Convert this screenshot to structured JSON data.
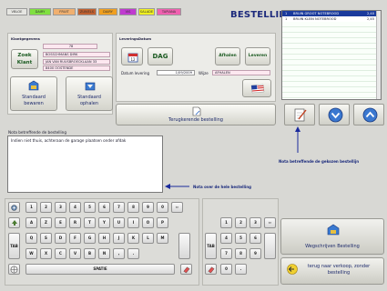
{
  "categories": [
    {
      "label": "VBLOE",
      "bg": "#e6e6e2"
    },
    {
      "label": "DAIRY",
      "bg": "#80e040"
    },
    {
      "label": "FRUIT",
      "bg": "#f0b070"
    },
    {
      "label": "ZUIVELS",
      "bg": "#c06030"
    },
    {
      "label": "DAIRY",
      "bg": "#f0a020"
    },
    {
      "label": "VIS",
      "bg": "#c03ad0"
    },
    {
      "label": "SALADE",
      "bg": "#f0f020"
    },
    {
      "label": "TAPIANA",
      "bg": "#f060b0"
    }
  ],
  "title": "BESTELLING",
  "order_lines": [
    {
      "qty": "1",
      "name": "BRUIN GROOT NOTEBROOD",
      "price": "2,40"
    },
    {
      "qty": "1",
      "name": "BRUIN KLEIN NOTEBROOD",
      "price": "2,45"
    }
  ],
  "customer": {
    "section_title": "Klantgegevens",
    "number": "78",
    "zoek_label": "Zoek",
    "klant_label": "Klant",
    "name": "BOSSCHMANS DIRK",
    "street": "JAN VAN RUUSBROECKLAAN 33",
    "city": "8400 OOSTENDE"
  },
  "delivery": {
    "section_title": "LeveringsDatum",
    "dag_label": "DAG",
    "afhalen_btn": "Afhalen",
    "leveren_btn": "Leveren",
    "datum_label": "Datum levering",
    "datum_value": "1/09/2009",
    "wijze_label": "Wijze",
    "wijze_value": "AFHALEN"
  },
  "standard": {
    "save_l1": "Standaard",
    "save_l2": "bewaren",
    "fetch_l1": "Standaard",
    "fetch_l2": "ophalen"
  },
  "recurring_label": "Terugkerende bestelling",
  "note": {
    "label": "Nota betreffende de bestelling",
    "text": "Indien niet thuis, achteraan de garage plaatsen onder afdak"
  },
  "annotations": {
    "product_note": "Nota betreffende de gekozen bestellijn",
    "order_note": "Nota over de hele bestelling"
  },
  "keyboard": {
    "row1": [
      "1",
      "2",
      "3",
      "4",
      "5",
      "6",
      "7",
      "8",
      "9",
      "0"
    ],
    "row2": [
      "A",
      "Z",
      "E",
      "R",
      "T",
      "Y",
      "U",
      "I",
      "O",
      "P"
    ],
    "row3": [
      "Q",
      "S",
      "D",
      "F",
      "G",
      "H",
      "J",
      "K",
      "L",
      "M"
    ],
    "row4": [
      "W",
      "X",
      "C",
      "V",
      "B",
      "N",
      ",",
      "."
    ],
    "tab": "TAB",
    "space": "SPATIE",
    "backspace": "⇦"
  },
  "numpad": {
    "row1": [
      "1",
      "2",
      "3"
    ],
    "row2": [
      "4",
      "5",
      "6"
    ],
    "row3": [
      "7",
      "8",
      "9"
    ],
    "row4": [
      "0",
      "."
    ],
    "tab": "TAB",
    "backspace": "⇦"
  },
  "actions": {
    "write_off": "Wegschrijven Bestelling",
    "back_l1": "terug naar verkoop, zonder",
    "back_l2": "bestelling"
  }
}
